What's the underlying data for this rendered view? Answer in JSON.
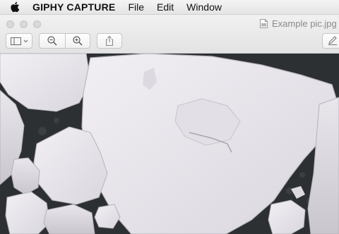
{
  "menubar": {
    "apple_icon": "apple-logo-icon",
    "app_name": "GIPHY CAPTURE",
    "items": [
      "File",
      "Edit",
      "Window"
    ]
  },
  "window": {
    "document_title": "Example pic.jpg",
    "document_icon": "jpg-file-icon",
    "toolbar": {
      "sidebar_button_icon": "sidebar-icon",
      "zoom_out_icon": "zoom-out-icon",
      "zoom_in_icon": "zoom-in-icon",
      "share_icon": "share-icon",
      "edit_icon": "pencil-icon"
    }
  },
  "content": {
    "image_subject": "ice-floes-photo"
  }
}
